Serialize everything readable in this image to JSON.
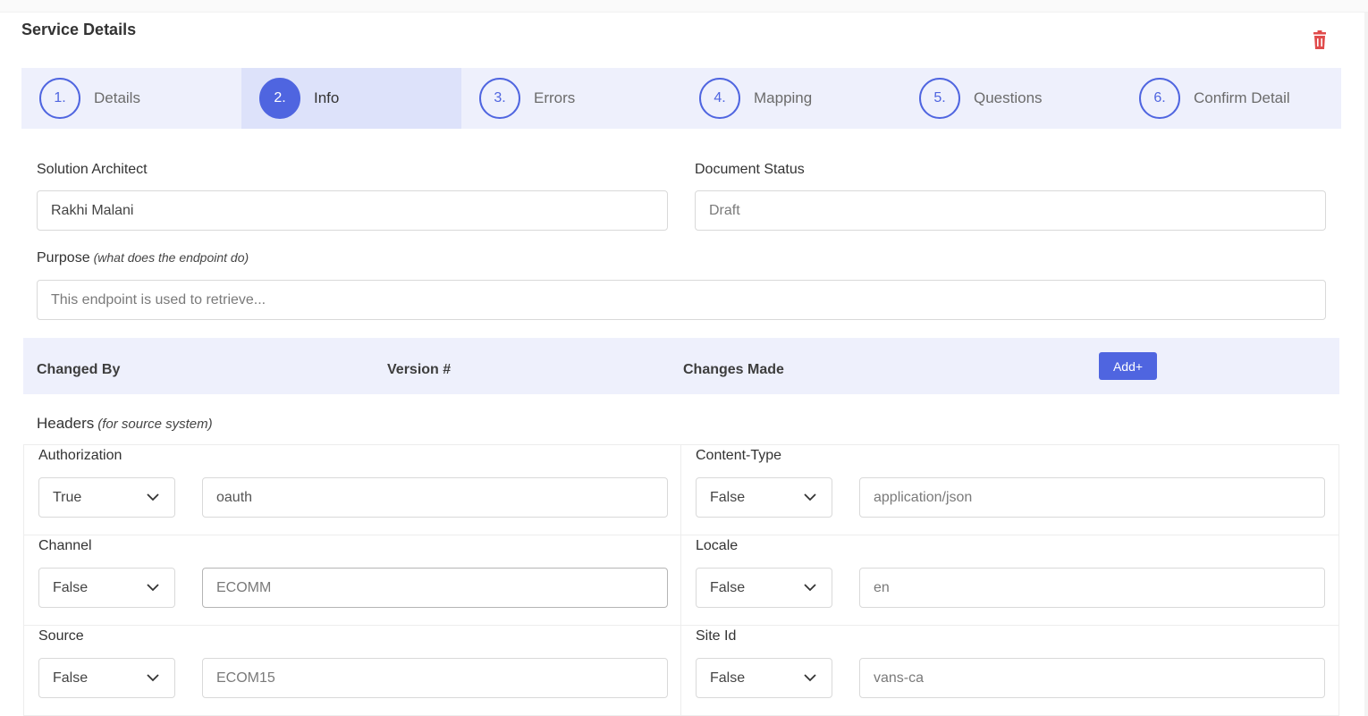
{
  "page": {
    "title": "Service Details"
  },
  "icons": {
    "delete": "trash-icon",
    "dropdown": "chevron-down-icon"
  },
  "colors": {
    "accent": "#4f65e0",
    "danger": "#e04b4b",
    "stepper_bg": "#eef0fc",
    "stepper_active_bg": "#dde2fa"
  },
  "steps": [
    {
      "number": "1.",
      "label": "Details"
    },
    {
      "number": "2.",
      "label": "Info"
    },
    {
      "number": "3.",
      "label": "Errors"
    },
    {
      "number": "4.",
      "label": "Mapping"
    },
    {
      "number": "5.",
      "label": "Questions"
    },
    {
      "number": "6.",
      "label": "Confirm Detail"
    }
  ],
  "active_step": 2,
  "form": {
    "solution_architect": {
      "label": "Solution Architect",
      "value": "Rakhi Malani"
    },
    "document_status": {
      "label": "Document Status",
      "value": "Draft"
    },
    "purpose": {
      "label": "Purpose",
      "hint": "(what does the endpoint do)",
      "placeholder": "This endpoint is used to retrieve..."
    }
  },
  "changes": {
    "columns": [
      "Changed By",
      "Version #",
      "Changes Made"
    ],
    "add_label": "Add+"
  },
  "headers": {
    "title": "Headers",
    "hint": "(for source system)",
    "items": [
      {
        "name": "Authorization",
        "required": "True",
        "value": "oauth"
      },
      {
        "name": "Content-Type",
        "required": "False",
        "value": "application/json"
      },
      {
        "name": "Channel",
        "required": "False",
        "value": "ECOMM"
      },
      {
        "name": "Locale",
        "required": "False",
        "value": "en"
      },
      {
        "name": "Source",
        "required": "False",
        "value": "ECOM15"
      },
      {
        "name": "Site Id",
        "required": "False",
        "value": "vans-ca"
      }
    ]
  }
}
